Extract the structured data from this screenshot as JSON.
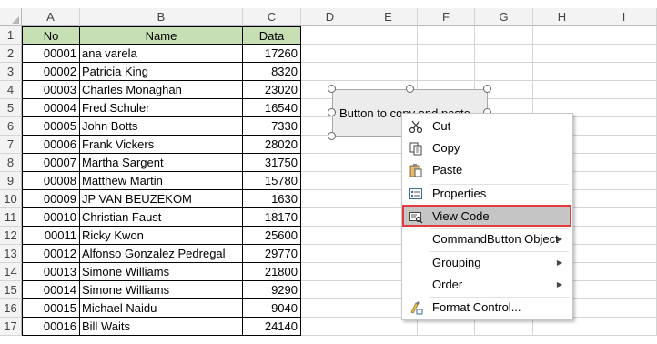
{
  "columns": [
    "A",
    "B",
    "C",
    "D",
    "E",
    "F",
    "G",
    "H",
    "I"
  ],
  "rows": [
    "1",
    "2",
    "3",
    "4",
    "5",
    "6",
    "7",
    "8",
    "9",
    "10",
    "11",
    "12",
    "13",
    "14",
    "15",
    "16",
    "17"
  ],
  "table": {
    "headers": [
      "No",
      "Name",
      "Data"
    ],
    "header_color": "#c6e0b4",
    "rows": [
      [
        "00001",
        "ana varela",
        "17260"
      ],
      [
        "00002",
        "Patricia King",
        "8320"
      ],
      [
        "00003",
        "Charles Monaghan",
        "23020"
      ],
      [
        "00004",
        "Fred Schuler",
        "16540"
      ],
      [
        "00005",
        "John Botts",
        "7330"
      ],
      [
        "00006",
        "Frank Vickers",
        "28020"
      ],
      [
        "00007",
        "Martha Sargent",
        "31750"
      ],
      [
        "00008",
        "Matthew Martin",
        "15780"
      ],
      [
        "00009",
        "JP VAN BEUZEKOM",
        "1630"
      ],
      [
        "00010",
        "Christian Faust",
        "18170"
      ],
      [
        "00011",
        "Ricky Kwon",
        "25600"
      ],
      [
        "00012",
        "Alfonso Gonzalez Pedregal",
        "29770"
      ],
      [
        "00013",
        "Simone Williams",
        "21800"
      ],
      [
        "00014",
        "Simone Williams",
        "9290"
      ],
      [
        "00015",
        "Michael Naidu",
        "9040"
      ],
      [
        "00016",
        "Bill Waits",
        "24140"
      ]
    ]
  },
  "command_button": {
    "label": "Button to copy and paste"
  },
  "context_menu": {
    "items": [
      {
        "label": "Cut",
        "icon": "scissors-icon"
      },
      {
        "label": "Copy",
        "icon": "copy-icon"
      },
      {
        "label": "Paste",
        "icon": "paste-icon"
      },
      {
        "label": "Properties",
        "icon": "properties-icon"
      },
      {
        "label": "View Code",
        "icon": "view-code-icon"
      },
      {
        "label": "CommandButton Object",
        "submenu": true
      },
      {
        "label": "Grouping",
        "submenu": true
      },
      {
        "label": "Order",
        "submenu": true
      },
      {
        "label": "Format Control...",
        "icon": "format-control-icon"
      }
    ],
    "highlight_color": "#e13b3b"
  }
}
